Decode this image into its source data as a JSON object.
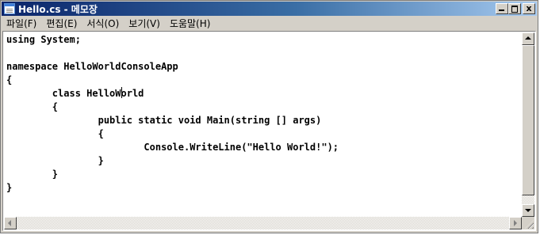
{
  "window": {
    "title": "Hello.cs - 메모장",
    "buttons": {
      "minimize": "_",
      "maximize": "□",
      "close": "x"
    }
  },
  "menu": {
    "items": [
      {
        "label": "파일(F)"
      },
      {
        "label": "편집(E)"
      },
      {
        "label": "서식(O)"
      },
      {
        "label": "보기(V)"
      },
      {
        "label": "도움말(H)"
      }
    ]
  },
  "editor": {
    "lines": [
      "using System;",
      "",
      "namespace HelloWorldConsoleApp",
      "{",
      "        class HelloWorld",
      "        {",
      "                public static void Main(string [] args)",
      "                {",
      "                        Console.WriteLine(\"Hello World!\");",
      "                }",
      "        }",
      "}"
    ],
    "caret_line": 5,
    "caret_before": "        class HelloW",
    "caret_after": "orld"
  },
  "icons": {
    "app": "notepad-icon",
    "scroll_up": "arrow-up-icon",
    "scroll_down": "arrow-down-icon",
    "scroll_left": "arrow-left-icon",
    "scroll_right": "arrow-right-icon"
  },
  "colors": {
    "titlebar_start": "#0a246a",
    "titlebar_end": "#a6caf0",
    "chrome": "#d4d0c8",
    "editor_bg": "#ffffff"
  }
}
